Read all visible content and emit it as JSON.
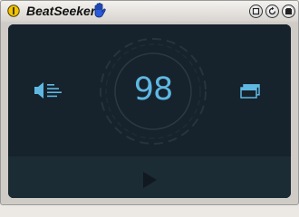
{
  "window": {
    "title": "BeatSeeker"
  },
  "main": {
    "bpm": "98"
  },
  "icons": {
    "app": "app-status-icon",
    "hand": "hand-icon",
    "speaker": "speaker-icon",
    "display": "window-icon",
    "play": "play-icon"
  },
  "colors": {
    "accent": "#5fb8e2",
    "panel_bg": "#16222c",
    "lower_bg": "#1c2c34",
    "play": "#11181f"
  }
}
